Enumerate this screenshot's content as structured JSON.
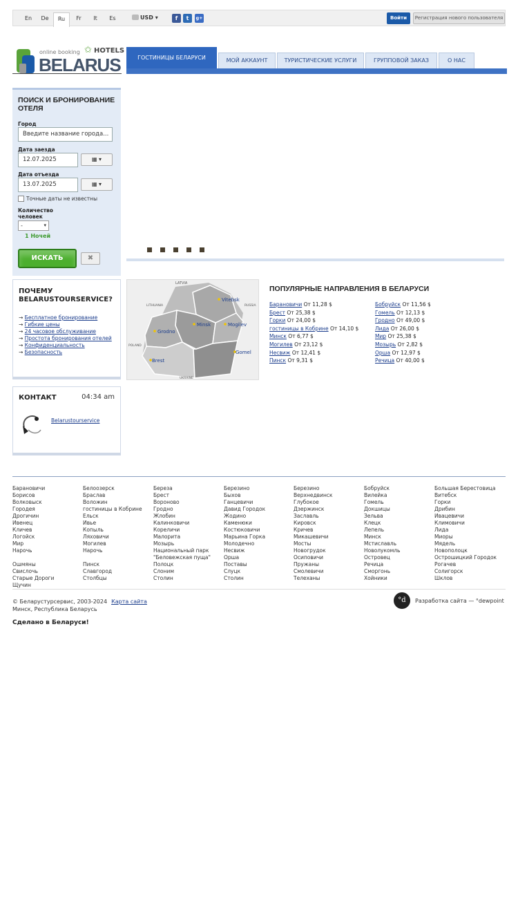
{
  "topbar": {
    "languages": [
      "En",
      "De",
      "Ru",
      "Fr",
      "It",
      "Es"
    ],
    "active_language": "Ru",
    "currency": "USD",
    "currency_arrow": "▾",
    "social": [
      "f",
      "t",
      "g+"
    ],
    "login_label": "Войти",
    "register_label": "Регистрация нового пользователя"
  },
  "logo": {
    "tagline": "online booking",
    "hotels": "HOTELS",
    "name": "BELARUS"
  },
  "nav": {
    "tabs": [
      "ГОСТИНИЦЫ БЕЛАРУСИ",
      "МОЙ АККАУНТ",
      "ТУРИСТИЧЕСКИЕ УСЛУГИ",
      "ГРУППОВОЙ ЗАКАЗ",
      "О НАС"
    ]
  },
  "search": {
    "title": "ПОИСК И БРОНИРОВАНИЕ ОТЕЛЯ",
    "city_label": "Город",
    "city_placeholder": "Введите название города...",
    "checkin_label": "Дата заезда",
    "checkin_value": "12.07.2025",
    "checkout_label": "Дата отъезда",
    "checkout_value": "13.07.2025",
    "calendar_glyph": "▦ ▾",
    "unknown_dates_label": "Точные даты не известны",
    "guests_label": "Количество человек",
    "guests_value": "-",
    "nights": "1 Ночей",
    "search_label": "ИСКАТЬ",
    "clear_glyph": "✖"
  },
  "why": {
    "title": "ПОЧЕМУ BELARUSTOURSERVICE?",
    "items": [
      "Бесплатное бронирование",
      "Гибкие цены",
      "24 часовое обслуживание",
      "Простота бронирования отелей",
      "Конфиденциальность",
      "Безопасность"
    ]
  },
  "contact": {
    "title": "КОНТАКТ",
    "time": "04:34 am",
    "skype_name": "Belarustourservice"
  },
  "map": {
    "countries": [
      "LATVIA",
      "LITHUANIA",
      "RUSSIA",
      "POLAND",
      "UKRAINE"
    ],
    "cities": [
      "Vitebsk",
      "Minsk",
      "Mogilev",
      "Grodno",
      "Brest",
      "Gomel"
    ]
  },
  "popular": {
    "title": "ПОПУЛЯРНЫЕ НАПРАВЛЕНИЯ В БЕЛАРУСИ",
    "left": [
      {
        "name": "Барановичи",
        "price": "От 11,28 $"
      },
      {
        "name": "Брест",
        "price": "От 25,38 $"
      },
      {
        "name": "Горки",
        "price": "От 24,00 $"
      },
      {
        "name": "гостиницы в Кобрине",
        "price": "От 14,10 $"
      },
      {
        "name": "Минск",
        "price": "От 6,77 $"
      },
      {
        "name": "Могилев",
        "price": "От 23,12 $"
      },
      {
        "name": "Несвиж",
        "price": "От 12,41 $"
      },
      {
        "name": "Пинск",
        "price": "От 9,31 $"
      }
    ],
    "right": [
      {
        "name": "Бобруйск",
        "price": "От 11,56 $"
      },
      {
        "name": "Гомель",
        "price": "От 12,13 $"
      },
      {
        "name": "Гродно",
        "price": "От 49,00 $"
      },
      {
        "name": "Лида",
        "price": "От 26,00 $"
      },
      {
        "name": "Мир",
        "price": "От 25,38 $"
      },
      {
        "name": "Мозырь",
        "price": "От 2,82 $"
      },
      {
        "name": "Орша",
        "price": "От 12,97 $"
      },
      {
        "name": "Речица",
        "price": "От 40,00 $"
      }
    ]
  },
  "footer": {
    "city_columns": [
      [
        "Барановичи",
        "Борисов",
        "Волковыск",
        "Городея",
        "Дрогичин",
        "Ивенец",
        "Кличев",
        "Логойск",
        "Мир",
        "Нарочь",
        "",
        "Ошмяны",
        "Свислочь",
        "Старые Дороги",
        "Щучин"
      ],
      [
        "Белоозерск",
        "Браслав",
        "Воложин",
        "гостиницы в Кобрине",
        "Ельск",
        "Ивье",
        "Копыль",
        "Ляховичи",
        "Могилев",
        "Нарочь",
        "",
        "Пинск",
        "Славгород",
        "Столбцы"
      ],
      [
        "Береза",
        "Брест",
        "Вороново",
        "Гродно",
        "Жлобин",
        "Калинковичи",
        "Кореличи",
        "Малорита",
        "Мозырь",
        "Национальный парк",
        "\"Беловежская пуща\"",
        "Полоцк",
        "Слоним",
        "Столин"
      ],
      [
        "Березино",
        "Быхов",
        "Ганцевичи",
        "Давид Городок",
        "Жодино",
        "Каменюки",
        "Костюковичи",
        "Марьина Горка",
        "Молодечно",
        "Несвиж",
        "Орша",
        "Поставы",
        "Слуцк",
        "Столин"
      ],
      [
        "Березино",
        "Верхнедвинск",
        "Глубокое",
        "Дзержинск",
        "Заславль",
        "Кировск",
        "Кричев",
        "Микашевичи",
        "Мосты",
        "Новогрудок",
        "Осиповичи",
        "Пружаны",
        "Смолевичи",
        "Телеханы"
      ],
      [
        "Бобруйск",
        "Вилейка",
        "Гомель",
        "Докшицы",
        "Зельва",
        "Клецк",
        "Лепель",
        "Минск",
        "Мстиславль",
        "Новолукомль",
        "Островец",
        "Речица",
        "Сморгонь",
        "Хойники"
      ],
      [
        "Большая Берестовица",
        "Витебск",
        "Горки",
        "Дрибин",
        "Ивацевичи",
        "Климовичи",
        "Лида",
        "Миоры",
        "Мядель",
        "Новополоцк",
        "Острошицкий Городок",
        "Рогачев",
        "Солигорск",
        "Шклов"
      ]
    ],
    "copyright": "© Беларустурсервис, 2003-2024",
    "sitemap": "Карта сайта",
    "address": "Минск, Республика Беларусь",
    "dev_logo": "°d",
    "dev_text": "Разработка сайта — °dewpoint",
    "made_in": "Сделано в Беларуси!"
  },
  "colors": {
    "nav_blue": "#2f67bf",
    "green": "#4caf2e",
    "panel": "#e3ebf6"
  }
}
